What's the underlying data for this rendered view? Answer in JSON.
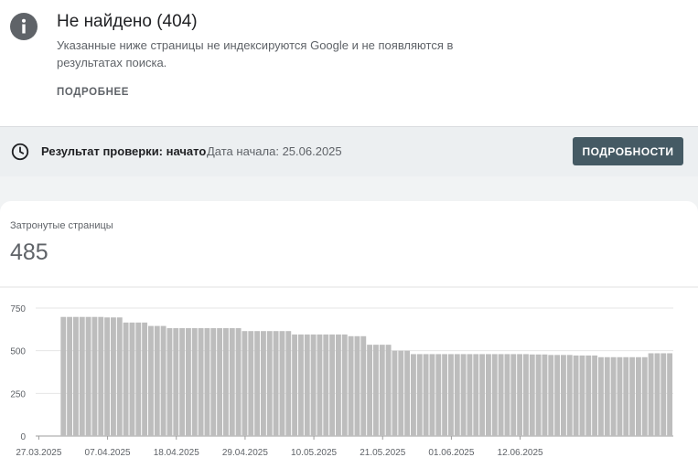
{
  "issue": {
    "title": "Не найдено (404)",
    "description": "Указанные ниже страницы не индексируются Google и не появляются в результатах поиска.",
    "more_label": "ПОДРОБНЕЕ"
  },
  "status": {
    "label": "Результат проверки: начато",
    "date": "Дата начала: 25.06.2025",
    "details_label": "ПОДРОБНОСТИ"
  },
  "metric": {
    "label": "Затронутые страницы",
    "value": "485"
  },
  "icons": {
    "info": "info-icon",
    "clock": "clock-icon"
  },
  "colors": {
    "bar": "#bdbdbd",
    "button_bg": "#455a64",
    "status_bg": "#eceff1"
  },
  "chart_data": {
    "type": "bar",
    "ylim": [
      0,
      750
    ],
    "yticks": [
      0,
      250,
      500,
      750
    ],
    "xtick_labels": [
      "27.03.2025",
      "07.04.2025",
      "18.04.2025",
      "29.04.2025",
      "10.05.2025",
      "21.05.2025",
      "01.06.2025",
      "12.06.2025"
    ],
    "xtick_indices": [
      0,
      11,
      22,
      33,
      44,
      55,
      66,
      77
    ],
    "grid": true,
    "values": [
      0,
      0,
      0,
      0,
      698,
      698,
      698,
      698,
      698,
      698,
      698,
      695,
      695,
      695,
      665,
      665,
      665,
      665,
      645,
      645,
      645,
      632,
      632,
      632,
      632,
      632,
      632,
      632,
      632,
      632,
      632,
      632,
      632,
      615,
      615,
      615,
      615,
      615,
      615,
      615,
      615,
      595,
      595,
      595,
      595,
      595,
      595,
      595,
      595,
      595,
      585,
      585,
      585,
      535,
      535,
      535,
      535,
      500,
      500,
      500,
      480,
      480,
      480,
      480,
      480,
      480,
      480,
      480,
      480,
      480,
      480,
      480,
      480,
      480,
      480,
      480,
      480,
      480,
      480,
      478,
      478,
      478,
      475,
      475,
      475,
      475,
      472,
      472,
      472,
      472,
      462,
      462,
      462,
      462,
      462,
      462,
      462,
      462,
      485,
      485,
      485,
      485
    ]
  }
}
